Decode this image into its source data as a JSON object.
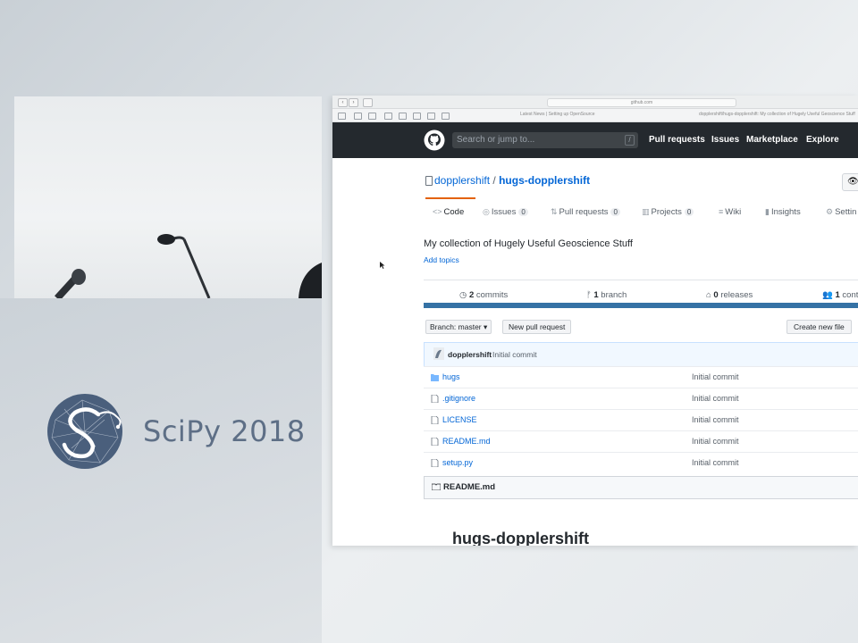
{
  "branding": {
    "logo_text": "SciPy 2018"
  },
  "browser": {
    "url_text": "github.com",
    "tab_title": "dopplershift/hugs-dopplershift: My collection of Hugely Useful Geoscience Stuff",
    "bookmark_text": "Latest News | Setting up OpenSource"
  },
  "github_header": {
    "search_placeholder": "Search or jump to...",
    "search_shortcut": "/",
    "nav": [
      "Pull requests",
      "Issues",
      "Marketplace",
      "Explore"
    ]
  },
  "repo": {
    "owner": "dopplershift",
    "separator": "/",
    "name": "hugs-dopplershift",
    "description": "My collection of Hugely Useful Geoscience Stuff",
    "add_topics": "Add topics"
  },
  "tabs": [
    {
      "label": "Code",
      "icon": "<>",
      "count": ""
    },
    {
      "label": "Issues",
      "icon": "◎",
      "count": "0"
    },
    {
      "label": "Pull requests",
      "icon": "⇅",
      "count": "0"
    },
    {
      "label": "Projects",
      "icon": "▥",
      "count": "0"
    },
    {
      "label": "Wiki",
      "icon": "≡",
      "count": ""
    },
    {
      "label": "Insights",
      "icon": "▮",
      "count": ""
    },
    {
      "label": "Settin",
      "icon": "⚙",
      "count": ""
    }
  ],
  "stats": {
    "commits_num": "2",
    "commits_label": "commits",
    "branches_num": "1",
    "branches_label": "branch",
    "releases_num": "0",
    "releases_label": "releases",
    "contributors_num": "1",
    "contributors_label": "cont"
  },
  "toolbar": {
    "branch_label": "Branch: master",
    "new_pr_label": "New pull request",
    "create_file_label": "Create new file"
  },
  "latest_commit": {
    "author": "dopplershift",
    "message": "Initial commit"
  },
  "files": [
    {
      "name": "hugs",
      "type": "folder",
      "message": "Initial commit"
    },
    {
      "name": ".gitignore",
      "type": "file",
      "message": "Initial commit"
    },
    {
      "name": "LICENSE",
      "type": "file",
      "message": "Initial commit"
    },
    {
      "name": "README.md",
      "type": "file",
      "message": "Initial commit"
    },
    {
      "name": "setup.py",
      "type": "file",
      "message": "Initial commit"
    }
  ],
  "readme": {
    "header": "README.md",
    "title": "hugs-dopplershift"
  },
  "colors": {
    "gh_header": "#24292e",
    "link": "#0366d6",
    "tab_accent": "#e36209",
    "lang_bar": "#3572a5",
    "scipy_text": "#5e6f86",
    "scipy_logo": "#4a5f7c"
  }
}
